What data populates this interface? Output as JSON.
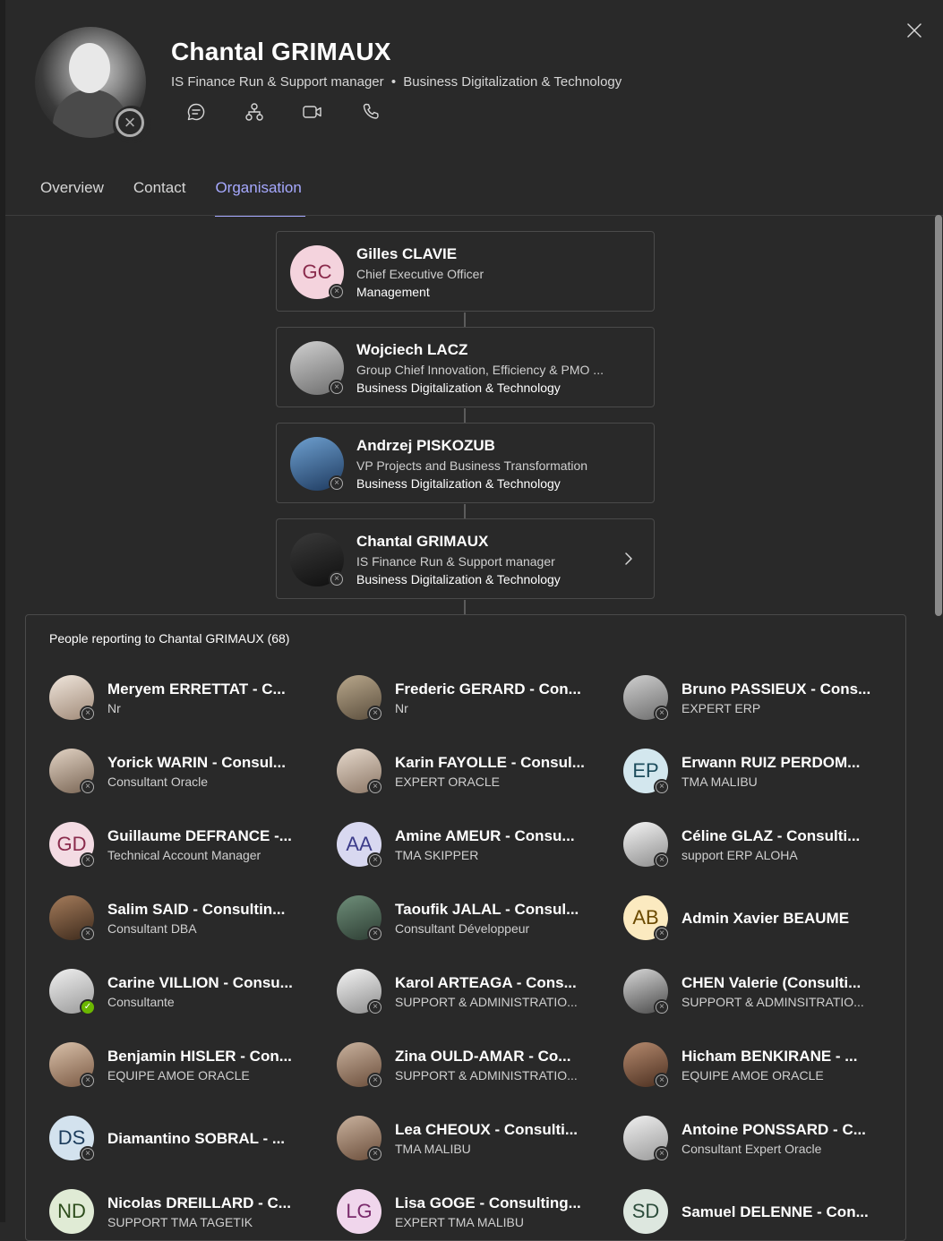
{
  "profile": {
    "name": "Chantal GRIMAUX",
    "title": "IS Finance Run & Support manager",
    "separator": "•",
    "department": "Business Digitalization & Technology",
    "actions": [
      "chat-icon",
      "org-chart-icon",
      "video-call-icon",
      "phone-call-icon"
    ]
  },
  "tabs": [
    {
      "label": "Overview",
      "active": false
    },
    {
      "label": "Contact",
      "active": false
    },
    {
      "label": "Organisation",
      "active": true
    }
  ],
  "colors": {
    "accent": "#a6a9ff",
    "background": "#292929",
    "available": "#6bb700"
  },
  "chain": [
    {
      "initials": "GC",
      "name": "Gilles CLAVIE",
      "title": "Chief Executive Officer",
      "department": "Management"
    },
    {
      "initials": "",
      "name": "Wojciech LACZ",
      "title": "Group Chief Innovation, Efficiency & PMO ...",
      "department": "Business Digitalization & Technology"
    },
    {
      "initials": "",
      "name": "Andrzej PISKOZUB",
      "title": "VP Projects and Business Transformation",
      "department": "Business Digitalization & Technology"
    },
    {
      "initials": "",
      "name": "Chantal GRIMAUX",
      "title": "IS Finance Run & Support manager",
      "department": "Business Digitalization & Technology"
    }
  ],
  "reports": {
    "heading": "People reporting to Chantal GRIMAUX (68)",
    "people": [
      {
        "name": "Meryem ERRETTAT - C...",
        "title": "Nr",
        "initials": "",
        "status": "offline"
      },
      {
        "name": "Frederic GERARD - Con...",
        "title": "Nr",
        "initials": "",
        "status": "offline"
      },
      {
        "name": "Bruno PASSIEUX - Cons...",
        "title": "EXPERT ERP",
        "initials": "",
        "status": "offline"
      },
      {
        "name": "Yorick WARIN - Consul...",
        "title": "Consultant Oracle",
        "initials": "",
        "status": "offline"
      },
      {
        "name": "Karin FAYOLLE - Consul...",
        "title": "EXPERT ORACLE",
        "initials": "",
        "status": "offline"
      },
      {
        "name": "Erwann RUIZ PERDOM...",
        "title": "TMA MALIBU",
        "initials": "EP",
        "status": "offline"
      },
      {
        "name": "Guillaume DEFRANCE -...",
        "title": "Technical Account Manager",
        "initials": "GD",
        "status": "offline"
      },
      {
        "name": "Amine AMEUR - Consu...",
        "title": "TMA SKIPPER",
        "initials": "AA",
        "status": "offline"
      },
      {
        "name": "Céline GLAZ - Consulti...",
        "title": "support ERP ALOHA",
        "initials": "",
        "status": "offline"
      },
      {
        "name": "Salim SAID - Consultin...",
        "title": "Consultant DBA",
        "initials": "",
        "status": "offline"
      },
      {
        "name": "Taoufik JALAL - Consul...",
        "title": "Consultant Développeur",
        "initials": "",
        "status": "offline"
      },
      {
        "name": "Admin Xavier BEAUME",
        "title": "",
        "initials": "AB",
        "status": "offline"
      },
      {
        "name": "Carine VILLION - Consu...",
        "title": "Consultante",
        "initials": "",
        "status": "available"
      },
      {
        "name": "Karol ARTEAGA - Cons...",
        "title": "SUPPORT & ADMINISTRATIO...",
        "initials": "",
        "status": "offline"
      },
      {
        "name": "CHEN Valerie (Consulti...",
        "title": "SUPPORT & ADMINSITRATIO...",
        "initials": "",
        "status": "offline"
      },
      {
        "name": "Benjamin HISLER - Con...",
        "title": "EQUIPE AMOE ORACLE",
        "initials": "",
        "status": "offline"
      },
      {
        "name": "Zina OULD-AMAR - Co...",
        "title": "SUPPORT & ADMINISTRATIO...",
        "initials": "",
        "status": "offline"
      },
      {
        "name": "Hicham BENKIRANE - ...",
        "title": "EQUIPE AMOE ORACLE",
        "initials": "",
        "status": "offline"
      },
      {
        "name": "Diamantino SOBRAL - ...",
        "title": "",
        "initials": "DS",
        "status": "offline"
      },
      {
        "name": "Lea CHEOUX - Consulti...",
        "title": "TMA MALIBU",
        "initials": "",
        "status": "offline"
      },
      {
        "name": "Antoine PONSSARD - C...",
        "title": "Consultant Expert Oracle",
        "initials": "",
        "status": "offline"
      },
      {
        "name": "Nicolas DREILLARD - C...",
        "title": "SUPPORT TMA TAGETIK",
        "initials": "ND",
        "status": "offline"
      },
      {
        "name": "Lisa GOGE - Consulting...",
        "title": "EXPERT TMA MALIBU",
        "initials": "LG",
        "status": "offline"
      },
      {
        "name": "Samuel DELENNE - Con...",
        "title": "",
        "initials": "SD",
        "status": "offline"
      }
    ]
  }
}
